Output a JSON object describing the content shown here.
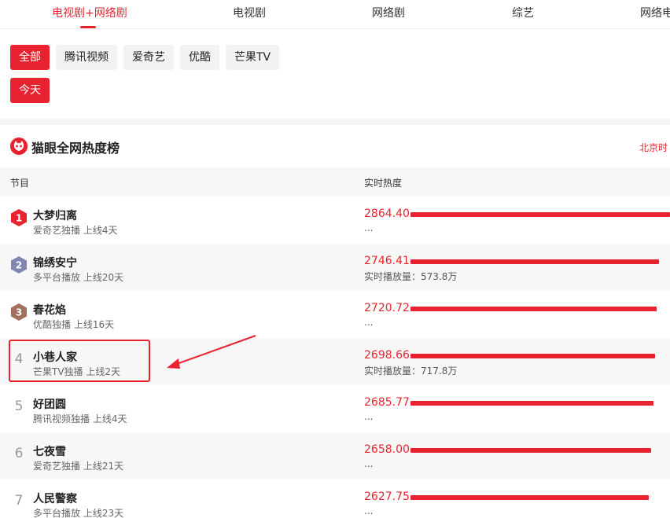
{
  "tabs": [
    {
      "label": "电视剧+网络剧",
      "active": true
    },
    {
      "label": "电视剧"
    },
    {
      "label": "网络剧"
    },
    {
      "label": "综艺"
    },
    {
      "label": "网络电"
    }
  ],
  "filters": {
    "platforms": [
      "全部",
      "腾讯视频",
      "爱奇艺",
      "优酷",
      "芒果TV"
    ],
    "date": "今天"
  },
  "heading": {
    "title": "猫眼全网热度榜",
    "region": "北京时"
  },
  "table": {
    "col_program": "节目",
    "col_heat": "实时热度",
    "max_heat": 2864.4,
    "rows": [
      {
        "rank": "1",
        "name": "大梦归离",
        "desc": "爱奇艺独播 上线4天",
        "heat": "2864.40",
        "heat_value": 2864.4,
        "sub": "..."
      },
      {
        "rank": "2",
        "name": "锦绣安宁",
        "desc": "多平台播放 上线20天",
        "heat": "2746.41",
        "heat_value": 2746.41,
        "sub": "实时播放量：573.8万"
      },
      {
        "rank": "3",
        "name": "春花焰",
        "desc": "优酷独播 上线16天",
        "heat": "2720.72",
        "heat_value": 2720.72,
        "sub": "..."
      },
      {
        "rank": "4",
        "name": "小巷人家",
        "desc": "芒果TV独播 上线2天",
        "heat": "2698.66",
        "heat_value": 2698.66,
        "sub": "实时播放量：717.8万"
      },
      {
        "rank": "5",
        "name": "好团圆",
        "desc": "腾讯视频独播 上线4天",
        "heat": "2685.77",
        "heat_value": 2685.77,
        "sub": "..."
      },
      {
        "rank": "6",
        "name": "七夜雪",
        "desc": "爱奇艺独播 上线21天",
        "heat": "2658.00",
        "heat_value": 2658.0,
        "sub": "..."
      },
      {
        "rank": "7",
        "name": "人民警察",
        "desc": "多平台播放 上线23天",
        "heat": "2627.75",
        "heat_value": 2627.75,
        "sub": "..."
      }
    ]
  },
  "colors": {
    "accent": "#e8232f",
    "medal_gold": "#e8232f",
    "medal_silver": "#7f86b0",
    "medal_bronze": "#a2705c"
  }
}
